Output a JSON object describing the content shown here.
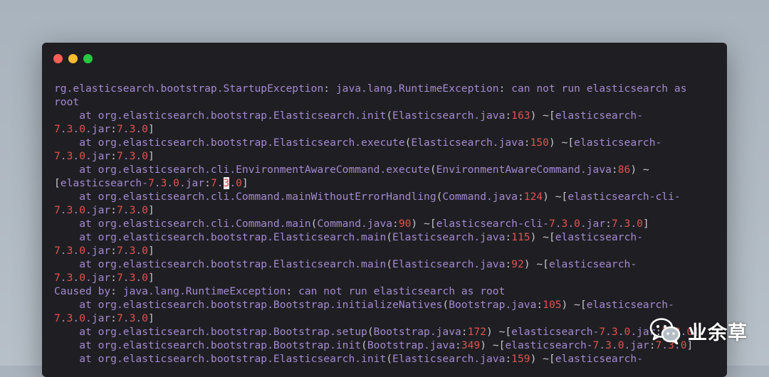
{
  "window": {
    "controls": [
      "close",
      "minimize",
      "maximize"
    ],
    "colors": {
      "close": "#ff5f57",
      "minimize": "#febc2e",
      "maximize": "#28c840"
    }
  },
  "terminal": {
    "lines": [
      "rg.elasticsearch.bootstrap.StartupException: java.lang.RuntimeException: can not run elasticsearch as",
      "root",
      "    at org.elasticsearch.bootstrap.Elasticsearch.init(Elasticsearch.java:163) ~[elasticsearch-",
      "7.3.0.jar:7.3.0]",
      "    at org.elasticsearch.bootstrap.Elasticsearch.execute(Elasticsearch.java:150) ~[elasticsearch-",
      "7.3.0.jar:7.3.0]",
      "    at org.elasticsearch.cli.EnvironmentAwareCommand.execute(EnvironmentAwareCommand.java:86) ~",
      "[elasticsearch-7.3.0.jar:7.3.0]",
      "    at org.elasticsearch.cli.Command.mainWithoutErrorHandling(Command.java:124) ~[elasticsearch-cli-",
      "7.3.0.jar:7.3.0]",
      "    at org.elasticsearch.cli.Command.main(Command.java:90) ~[elasticsearch-cli-7.3.0.jar:7.3.0]",
      "    at org.elasticsearch.bootstrap.Elasticsearch.main(Elasticsearch.java:115) ~[elasticsearch-",
      "7.3.0.jar:7.3.0]",
      "    at org.elasticsearch.bootstrap.Elasticsearch.main(Elasticsearch.java:92) ~[elasticsearch-",
      "7.3.0.jar:7.3.0]",
      "Caused by: java.lang.RuntimeException: can not run elasticsearch as root",
      "    at org.elasticsearch.bootstrap.Bootstrap.initializeNatives(Bootstrap.java:105) ~[elasticsearch-",
      "7.3.0.jar:7.3.0]",
      "    at org.elasticsearch.bootstrap.Bootstrap.setup(Bootstrap.java:172) ~[elasticsearch-7.3.0.jar:7.3.0]",
      "    at org.elasticsearch.bootstrap.Bootstrap.init(Bootstrap.java:349) ~[elasticsearch-7.3.0.jar:7.3.0]",
      "    at org.elasticsearch.bootstrap.Elasticsearch.init(Elasticsearch.java:159) ~[elasticsearch-"
    ],
    "cursor": {
      "line": 7,
      "char": 27
    },
    "colors": {
      "text": "#a48ad2",
      "number": "#e0534f",
      "punct": "#c7c4cc",
      "background": "#1f1f23"
    }
  },
  "watermark": {
    "icon": "wechat-icon",
    "text": "业余草"
  }
}
